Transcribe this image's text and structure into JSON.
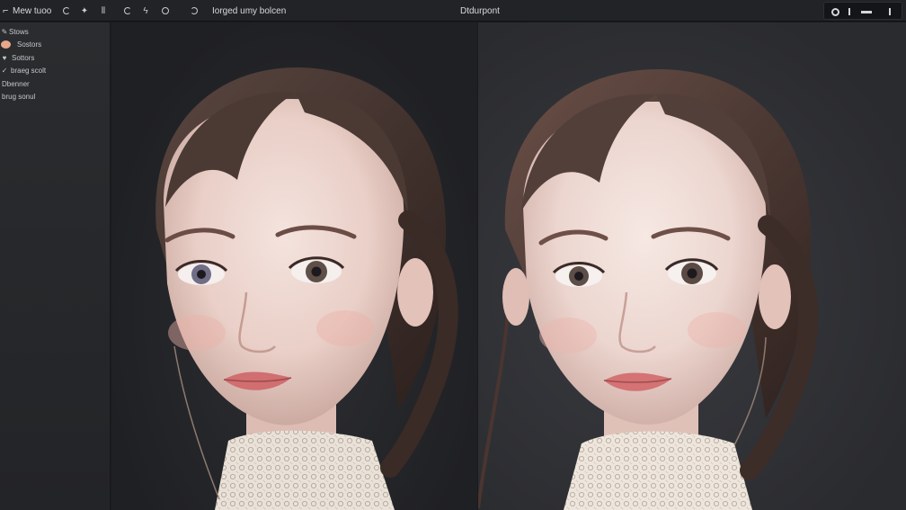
{
  "toolbar": {
    "title": "Mew tuoo",
    "doc_label": "Iorged umy bolcen",
    "viewport_label": "Dtdurpont",
    "icons": [
      "refresh-icon",
      "star-icon",
      "pin-icon",
      "rotate-icon",
      "circle-icon",
      "half-circle-icon",
      "settings-icon",
      "minimize-icon"
    ]
  },
  "sidebar": {
    "items": [
      {
        "glyph": "✎",
        "label": "Stows"
      },
      {
        "glyph": "",
        "label": "Sostors",
        "swatch": "#e8a88a"
      },
      {
        "glyph": "♥",
        "label": "Sottors"
      },
      {
        "glyph": "✓",
        "label": "braeg scolt"
      },
      {
        "glyph": "",
        "label": "Dbenner"
      },
      {
        "glyph": "",
        "label": "brug sonul"
      }
    ]
  },
  "viewport": {
    "panels": [
      "left-render",
      "right-render"
    ]
  }
}
